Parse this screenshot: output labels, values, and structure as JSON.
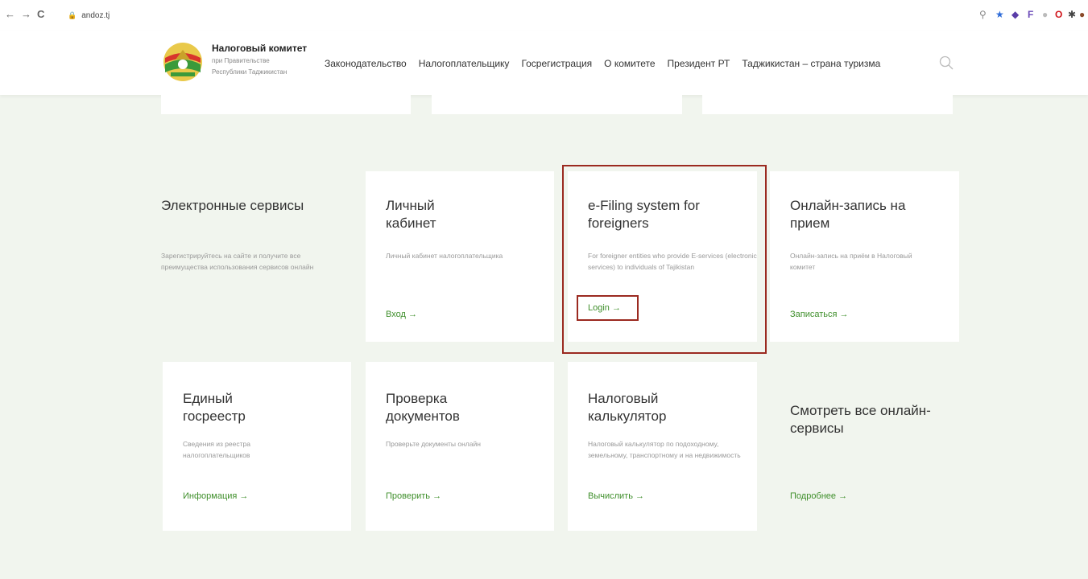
{
  "browser": {
    "back": "←",
    "forward": "→",
    "reload": "C",
    "url": "andoz.tj"
  },
  "header": {
    "title": "Налоговый комитет",
    "subtitle_line1": "при Правительстве",
    "subtitle_line2": "Республики Таджикистан",
    "nav": [
      "Законодательство",
      "Налогоплательщику",
      "Госрегистрация",
      "О комитете",
      "Президент РТ",
      "Таджикистан – страна туризма"
    ]
  },
  "cards": {
    "eservices": {
      "title": "Электронные сервисы",
      "desc": "Зарегистрируйтесь на сайте и получите все преимущества использования сервисов онлайн"
    },
    "cabinet": {
      "title": "Личный кабинет",
      "desc": "Личный кабинет налогоплательщика",
      "link": "Вход →"
    },
    "efiling": {
      "title": "e-Filing system for foreigners",
      "desc": "For foreigner entities who provide E-services (electronic services) to individuals of Tajikistan",
      "link": "Login →"
    },
    "appointment": {
      "title": "Онлайн-запись на прием",
      "desc": "Онлайн-запись на приём в Налоговый комитет",
      "link": "Записаться →"
    },
    "registry": {
      "title": "Единый госреестр",
      "desc": "Сведения из реестра налогоплательщиков",
      "link": "Информация →"
    },
    "docs": {
      "title": "Проверка документов",
      "desc": "Проверьте документы онлайн",
      "link": "Проверить →"
    },
    "calc": {
      "title": "Налоговый калькулятор",
      "desc": "Налоговый калькулятор по подоходному, земельному, транспортному и на недвижимость",
      "link": "Вычислить →"
    },
    "all": {
      "title": "Смотреть все онлайн-сервисы",
      "link": "Подробнее →"
    }
  },
  "colors": {
    "accent": "#3f8f2b",
    "background": "#f1f5ee",
    "highlight": "#9b2a20"
  }
}
